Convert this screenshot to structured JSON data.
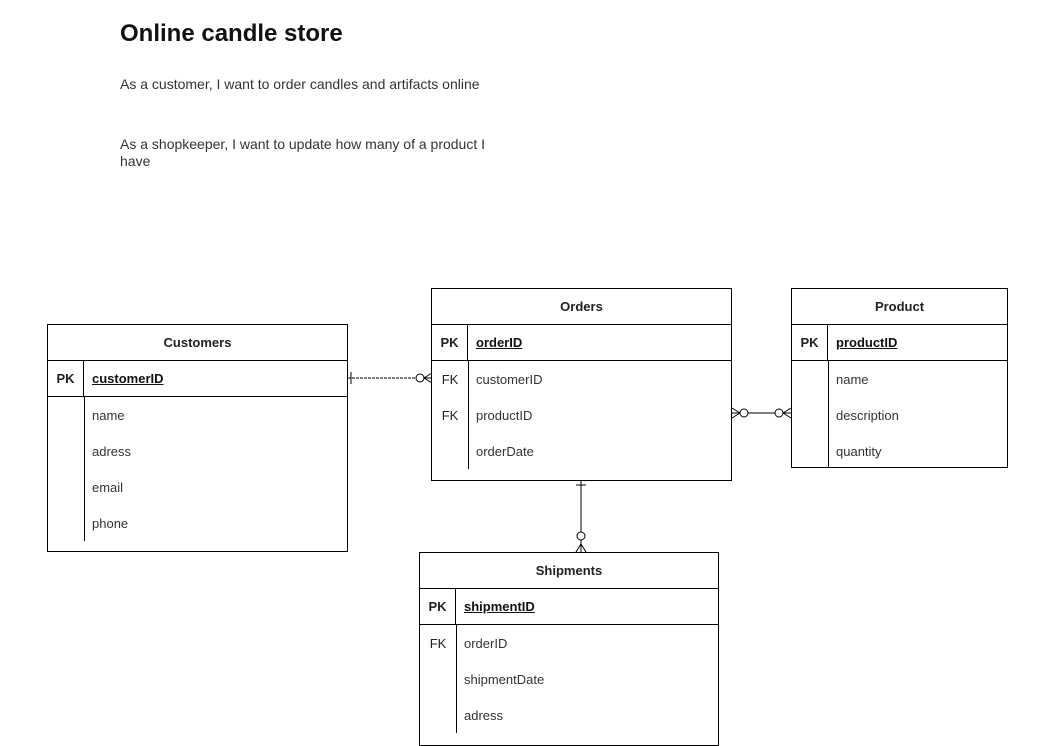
{
  "title": "Online candle store",
  "stories": [
    "As a customer, I want to order candles and artifacts online",
    "As a shopkeeper, I want to update how many of a product I have"
  ],
  "entities": {
    "customers": {
      "name": "Customers",
      "pk": {
        "key": "PK",
        "field": "customerID"
      },
      "fields": [
        {
          "key": "",
          "field": "name"
        },
        {
          "key": "",
          "field": "adress"
        },
        {
          "key": "",
          "field": "email"
        },
        {
          "key": "",
          "field": "phone"
        }
      ]
    },
    "orders": {
      "name": "Orders",
      "pk": {
        "key": "PK",
        "field": "orderID"
      },
      "fields": [
        {
          "key": "FK",
          "field": "customerID"
        },
        {
          "key": "FK",
          "field": "productID"
        },
        {
          "key": "",
          "field": "orderDate"
        }
      ]
    },
    "product": {
      "name": "Product",
      "pk": {
        "key": "PK",
        "field": "productID"
      },
      "fields": [
        {
          "key": "",
          "field": "name"
        },
        {
          "key": "",
          "field": "description"
        },
        {
          "key": "",
          "field": "quantity"
        }
      ]
    },
    "shipments": {
      "name": "Shipments",
      "pk": {
        "key": "PK",
        "field": "shipmentID"
      },
      "fields": [
        {
          "key": "FK",
          "field": "orderID"
        },
        {
          "key": "",
          "field": "shipmentDate"
        },
        {
          "key": "",
          "field": "adress"
        }
      ]
    }
  },
  "relationships": [
    {
      "from": "customers",
      "to": "orders",
      "from_end": "one",
      "to_end": "zero-or-many"
    },
    {
      "from": "orders",
      "to": "product",
      "from_end": "zero-or-many",
      "to_end": "zero-or-many"
    },
    {
      "from": "orders",
      "to": "shipments",
      "from_end": "one",
      "to_end": "zero-or-many"
    }
  ]
}
